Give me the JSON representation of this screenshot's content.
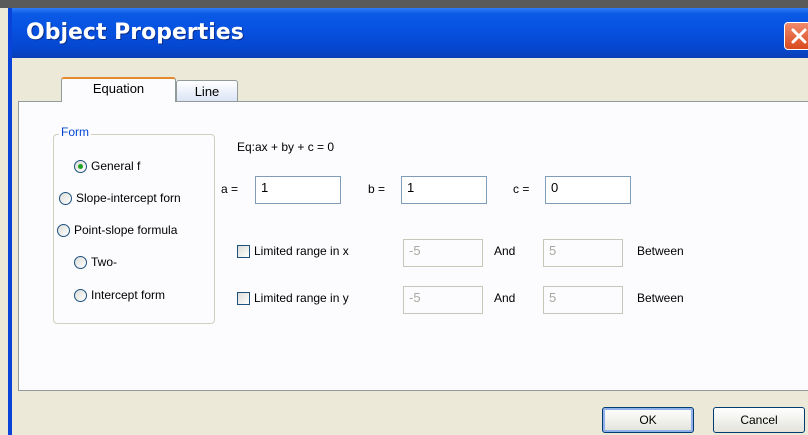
{
  "window": {
    "title": "Object Properties"
  },
  "tabs": [
    {
      "label": "Equation",
      "active": true
    },
    {
      "label": "Line",
      "active": false
    }
  ],
  "form": {
    "title": "Form",
    "options": [
      {
        "label": "General f",
        "selected": true
      },
      {
        "label": "Slope-intercept forn",
        "selected": false
      },
      {
        "label": "Point-slope formula",
        "selected": false
      },
      {
        "label": "Two-",
        "selected": false
      },
      {
        "label": "Intercept form",
        "selected": false
      }
    ]
  },
  "equation": {
    "text": "Eq:ax + by + c = 0",
    "a_label": "a =",
    "a_value": "1",
    "b_label": "b =",
    "b_value": "1",
    "c_label": "c =",
    "c_value": "0"
  },
  "range_x": {
    "label": "Limited range in x",
    "from": "-5",
    "and_label": "And",
    "to": "5",
    "between_label": "Between",
    "checked": false
  },
  "range_y": {
    "label": "Limited range in y",
    "from": "-5",
    "and_label": "And",
    "to": "5",
    "between_label": "Between",
    "checked": false
  },
  "buttons": {
    "ok": "OK",
    "cancel": "Cancel"
  },
  "colors": {
    "titlebar": "#0751e0",
    "group_title": "#0046d5",
    "radio_dot": "#21a121",
    "tab_highlight": "#e68b2c"
  }
}
